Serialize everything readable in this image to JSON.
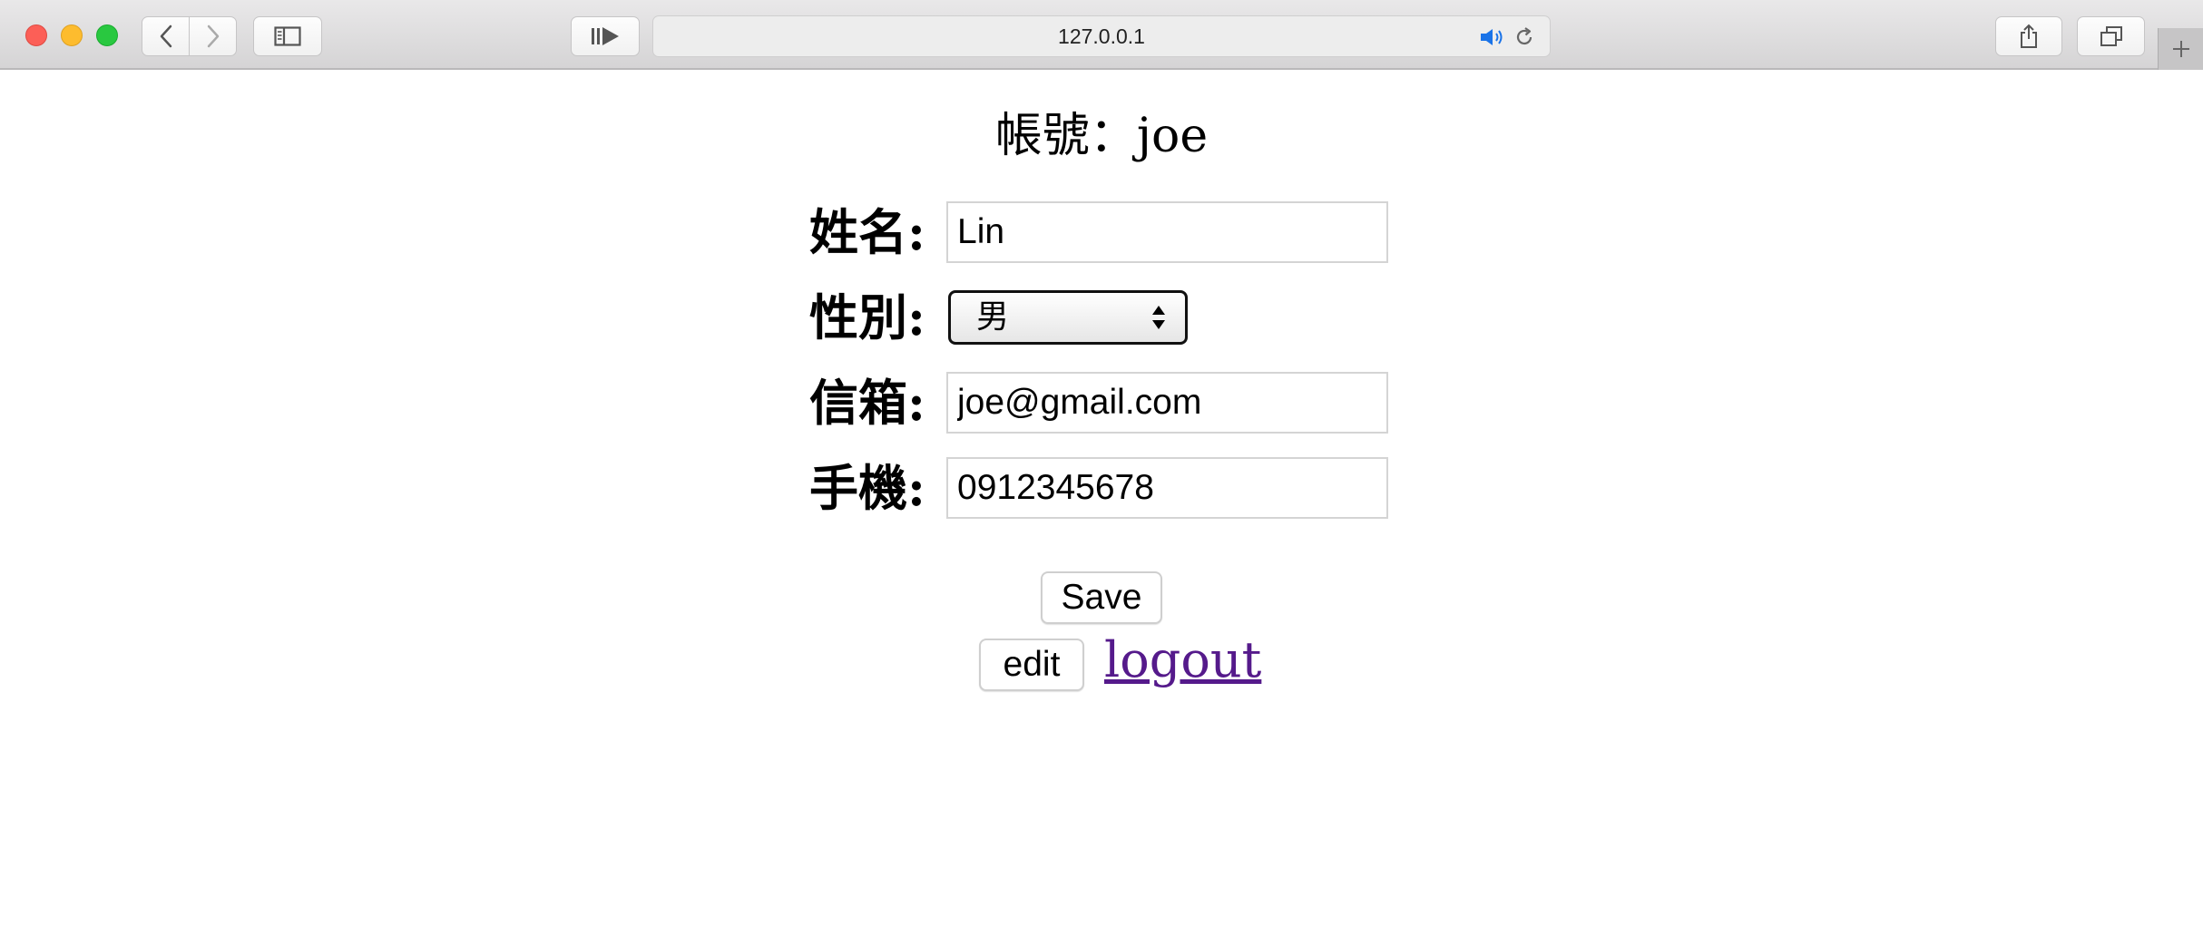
{
  "browser": {
    "url": "127.0.0.1",
    "icons": {
      "close": "close-icon",
      "minimize": "minimize-icon",
      "maximize": "maximize-icon",
      "back": "chevron-left-icon",
      "forward": "chevron-right-icon",
      "sidebar": "sidebar-icon",
      "reader": "reader-icon",
      "audio": "speaker-icon",
      "reload": "reload-icon",
      "share": "share-icon",
      "tabs": "tabs-overview-icon",
      "new_tab": "plus-icon"
    }
  },
  "page": {
    "account_heading": "帳號：joe",
    "form": {
      "name_label": "姓名:",
      "name_value": "Lin",
      "gender_label": "性別:",
      "gender_value": "男",
      "email_label": "信箱:",
      "email_value": "joe@gmail.com",
      "phone_label": "手機:",
      "phone_value": "0912345678"
    },
    "save_label": "Save",
    "edit_label": "edit",
    "logout_label": "logout"
  },
  "colors": {
    "link_visited": "#551a8b",
    "audio_icon": "#1a73e8"
  }
}
